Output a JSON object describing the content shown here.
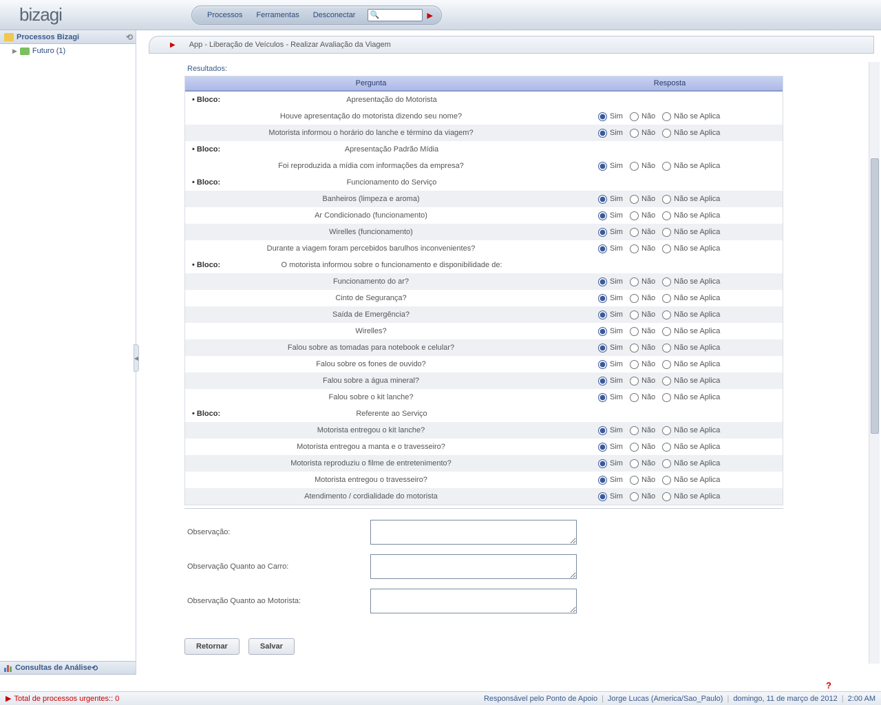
{
  "logo": "bizagi",
  "menu": {
    "processos": "Processos",
    "ferramentas": "Ferramentas",
    "desconectar": "Desconectar"
  },
  "search": {
    "placeholder": ""
  },
  "sidebar": {
    "header1": "Processos Bizagi",
    "tree": {
      "futuro": "Futuro (1)"
    },
    "header2": "Consultas de Análise"
  },
  "breadcrumb": "App - Liberação de Veículos - Realizar Avaliação da Viagem",
  "resultsLabel": "Resultados:",
  "columns": {
    "pergunta": "Pergunta",
    "resposta": "Resposta"
  },
  "blockLabel": "• Bloco:",
  "options": {
    "sim": "Sim",
    "nao": "Não",
    "na": "Não se Aplica"
  },
  "blocks": [
    {
      "title": "Apresentação do Motorista",
      "questions": [
        "Houve apresentação do motorista dizendo seu nome?",
        "Motorista informou o horário do lanche e término da viagem?"
      ]
    },
    {
      "title": "Apresentação Padrão Mídia",
      "questions": [
        "Foi reproduzida a mídia com informações da empresa?"
      ]
    },
    {
      "title": "Funcionamento do Serviço",
      "questions": [
        "Banheiros (limpeza e aroma)",
        "Ar Condicionado (funcionamento)",
        "Wirelles (funcionamento)",
        "Durante a viagem foram percebidos barulhos inconvenientes?"
      ]
    },
    {
      "title": "O motorista informou sobre o funcionamento e disponibilidade de:",
      "questions": [
        "Funcionamento do ar?",
        "Cinto de Segurança?",
        "Saída de Emergência?",
        "Wirelles?",
        "Falou sobre as tomadas para notebook e celular?",
        "Falou sobre os fones de ouvido?",
        "Falou sobre a água mineral?",
        "Falou sobre o kit lanche?"
      ]
    },
    {
      "title": "Referente ao Serviço",
      "questions": [
        "Motorista entregou o kit lanche?",
        "Motorista entregou a manta e o travesseiro?",
        "Motorista reproduziu o filme de entretenimento?",
        "Motorista entregou o travesseiro?",
        "Atendimento / cordialidade do motorista"
      ]
    }
  ],
  "obs": {
    "label1": "Observação:",
    "label2": "Observação Quanto ao Carro:",
    "label3": "Observação Quanto ao Motorista:"
  },
  "buttons": {
    "retornar": "Retornar",
    "salvar": "Salvar"
  },
  "status": {
    "urgent": "Total de processos urgentes:: 0",
    "responsavel": "Responsável pelo Ponto de Apoio",
    "user": "Jorge Lucas (America/Sao_Paulo)",
    "date": "domingo, 11 de março de 2012",
    "time": "2:00 AM"
  }
}
